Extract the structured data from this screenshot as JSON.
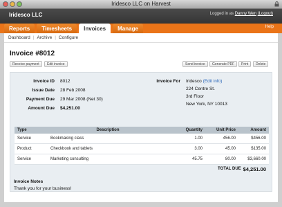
{
  "window": {
    "title": "Iridesco LLC on Harvest"
  },
  "header": {
    "company": "Iridesco LLC",
    "login_prefix": "Logged in as",
    "user_name": "Danny Wen",
    "logout": "(Logout)"
  },
  "tabs": [
    {
      "label": "Reports"
    },
    {
      "label": "Timesheets"
    },
    {
      "label": "Invoices"
    },
    {
      "label": "Manage"
    }
  ],
  "help_label": "Help",
  "subnav": [
    {
      "label": "Dashboard"
    },
    {
      "label": "Archive"
    },
    {
      "label": "Configure"
    }
  ],
  "invoice": {
    "title": "Invoice #8012",
    "actions": {
      "receive_payment": "Receive payment",
      "edit_invoice": "Edit invoice",
      "send_invoice": "Send invoice",
      "generate_pdf": "Generate PDF",
      "print": "Print",
      "delete": "Delete"
    },
    "fields": {
      "id_label": "Invoice ID",
      "id_value": "8012",
      "issue_label": "Issue Date",
      "issue_value": "28 Feb 2008",
      "due_label": "Payment Due",
      "due_value": "29 Mar 2008 (Net 30)",
      "amount_label": "Amount Due",
      "amount_value": "$4,251.00"
    },
    "invoice_for": {
      "label": "Invoice For",
      "client": "Iridesco",
      "edit_link": "(Edit info)",
      "address_line1": "224 Centre St.",
      "address_line2": "3rd Floor",
      "address_line3": "New York, NY 10013"
    },
    "table": {
      "headers": {
        "type": "Type",
        "description": "Description",
        "quantity": "Quantity",
        "unit_price": "Unit Price",
        "amount": "Amount"
      },
      "rows": [
        {
          "type": "Service",
          "description": "Bookmaking class",
          "quantity": "1.00",
          "unit_price": "456.00",
          "amount": "$456.00"
        },
        {
          "type": "Product",
          "description": "Checkbook and tablets",
          "quantity": "3.00",
          "unit_price": "45.00",
          "amount": "$135.00"
        },
        {
          "type": "Service",
          "description": "Marketing consulting",
          "quantity": "45.75",
          "unit_price": "80.00",
          "amount": "$3,660.00"
        }
      ],
      "total_label": "TOTAL DUE",
      "total_value": "$4,251.00"
    },
    "notes": {
      "title": "Invoice Notes",
      "text": "Thank you for your business!"
    }
  },
  "colors": {
    "accent": "#ea7418",
    "header_bg": "#2f2f2f",
    "link": "#2a66b8"
  }
}
